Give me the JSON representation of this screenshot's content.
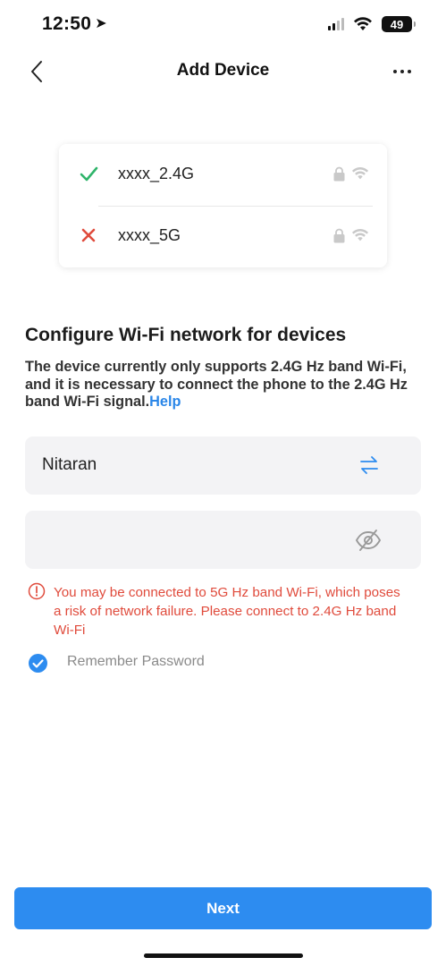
{
  "status_bar": {
    "time": "12:50",
    "battery": "49"
  },
  "nav": {
    "title": "Add Device"
  },
  "wifi_examples": [
    {
      "name": "xxxx_2.4G",
      "supported": true
    },
    {
      "name": "xxxx_5G",
      "supported": false
    }
  ],
  "content": {
    "heading": "Configure Wi-Fi network for devices",
    "description": "The device currently only supports 2.4G Hz band Wi-Fi, and it is necessary to connect the phone to the 2.4G Hz band Wi-Fi signal.",
    "help_link": "Help"
  },
  "form": {
    "ssid_value": "Nitaran",
    "password_value": ""
  },
  "warning": {
    "text": "You may be connected to 5G Hz band Wi-Fi, which poses a risk of network failure. Please connect to 2.4G Hz band Wi-Fi"
  },
  "remember": {
    "label": "Remember Password",
    "checked": true
  },
  "next_button": {
    "label": "Next"
  },
  "colors": {
    "accent": "#2d8cf0",
    "success": "#2fb46a",
    "error": "#e04b3c"
  }
}
